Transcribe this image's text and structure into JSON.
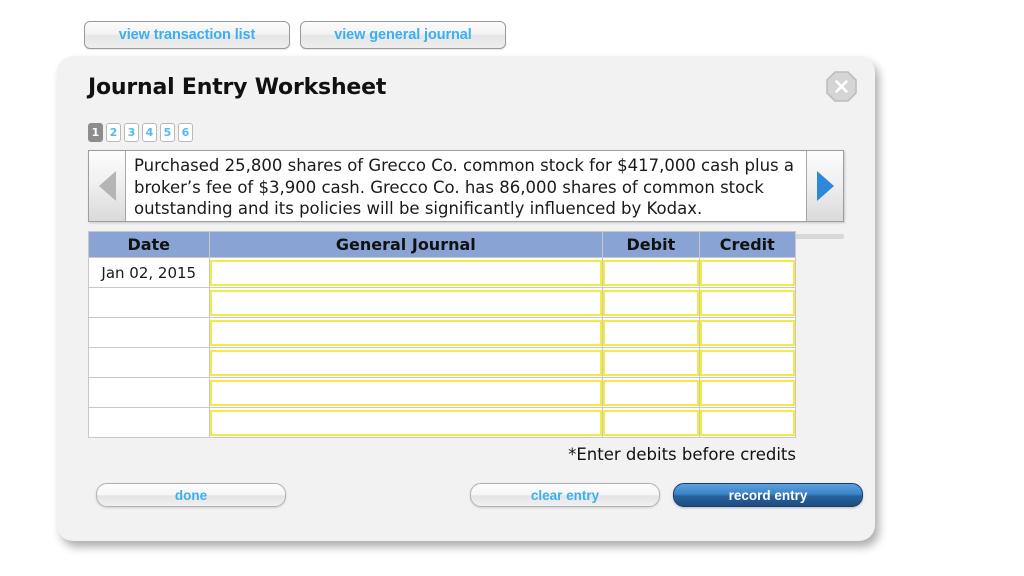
{
  "toolbar": {
    "view_transaction_list": "view transaction list",
    "view_general_journal": "view general journal"
  },
  "panel": {
    "title": "Journal Entry Worksheet",
    "close_label": "X",
    "close_icon": "close-icon"
  },
  "pager": {
    "items": [
      {
        "label": "1",
        "active": true
      },
      {
        "label": "2",
        "active": false
      },
      {
        "label": "3",
        "active": false
      },
      {
        "label": "4",
        "active": false
      },
      {
        "label": "5",
        "active": false
      },
      {
        "label": "6",
        "active": false
      }
    ]
  },
  "description": {
    "prev_icon": "triangle-left-icon",
    "next_icon": "triangle-right-icon",
    "text": "Purchased 25,800 shares of Grecco Co. common stock for $417,000 cash plus a broker’s fee of $3,900 cash. Grecco Co. has 86,000 shares of common stock outstanding and its policies will be significantly influenced by Kodax."
  },
  "table": {
    "headers": [
      "Date",
      "General Journal",
      "Debit",
      "Credit"
    ],
    "rows": [
      {
        "date": "Jan 02, 2015",
        "general_journal": "",
        "debit": "",
        "credit": ""
      },
      {
        "date": "",
        "general_journal": "",
        "debit": "",
        "credit": ""
      },
      {
        "date": "",
        "general_journal": "",
        "debit": "",
        "credit": ""
      },
      {
        "date": "",
        "general_journal": "",
        "debit": "",
        "credit": ""
      },
      {
        "date": "",
        "general_journal": "",
        "debit": "",
        "credit": ""
      },
      {
        "date": "",
        "general_journal": "",
        "debit": "",
        "credit": ""
      }
    ]
  },
  "note": "*Enter debits before credits",
  "footer": {
    "done": "done",
    "clear_entry": "clear entry",
    "record_entry": "record entry"
  },
  "colors": {
    "accent_blue_text": "#3ab0f0",
    "table_header": "#88a3d4",
    "input_border_yellow": "#f3ea48",
    "record_entry_blue": "#28639f",
    "panel_bg": "#f2f2f2",
    "pager_active_bg": "#8d8d8d"
  }
}
